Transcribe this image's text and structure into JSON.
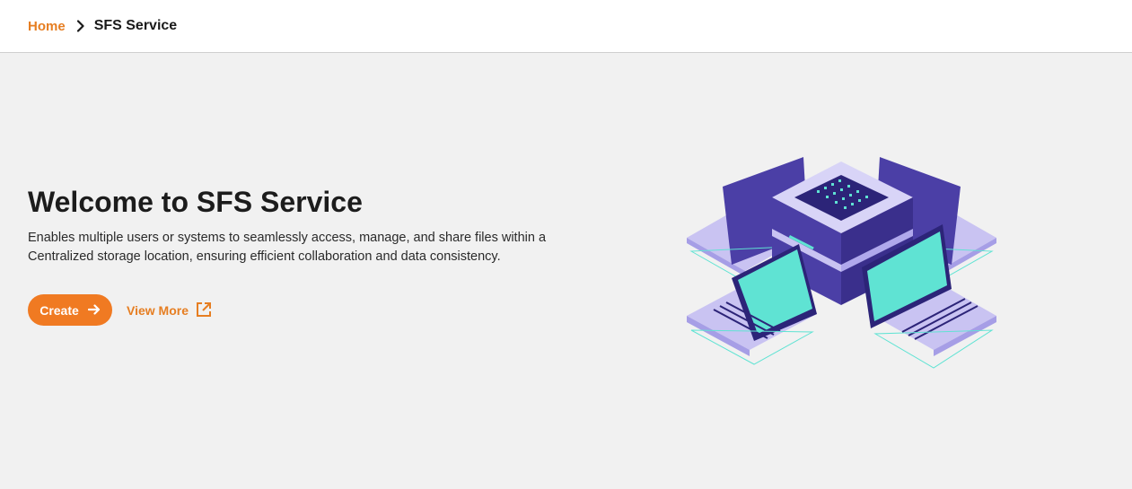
{
  "breadcrumb": {
    "home_label": "Home",
    "current_label": "SFS Service"
  },
  "hero": {
    "title": "Welcome to SFS Service",
    "description_line1": "Enables multiple users or systems to seamlessly access, manage, and share files within a",
    "description_line2": "Centralized storage location, ensuring efficient collaboration and data consistency.",
    "create_label": "Create",
    "view_more_label": "View More"
  },
  "icons": {
    "breadcrumb_separator": "chevron-right-icon",
    "create": "arrow-right-icon",
    "view_more": "external-link-icon"
  },
  "colors": {
    "accent": "#f07a22",
    "link": "#e67e22",
    "background": "#f1f1f1",
    "illustration_purple": "#4b3fa6",
    "illustration_screen": "#5fe3d3"
  }
}
